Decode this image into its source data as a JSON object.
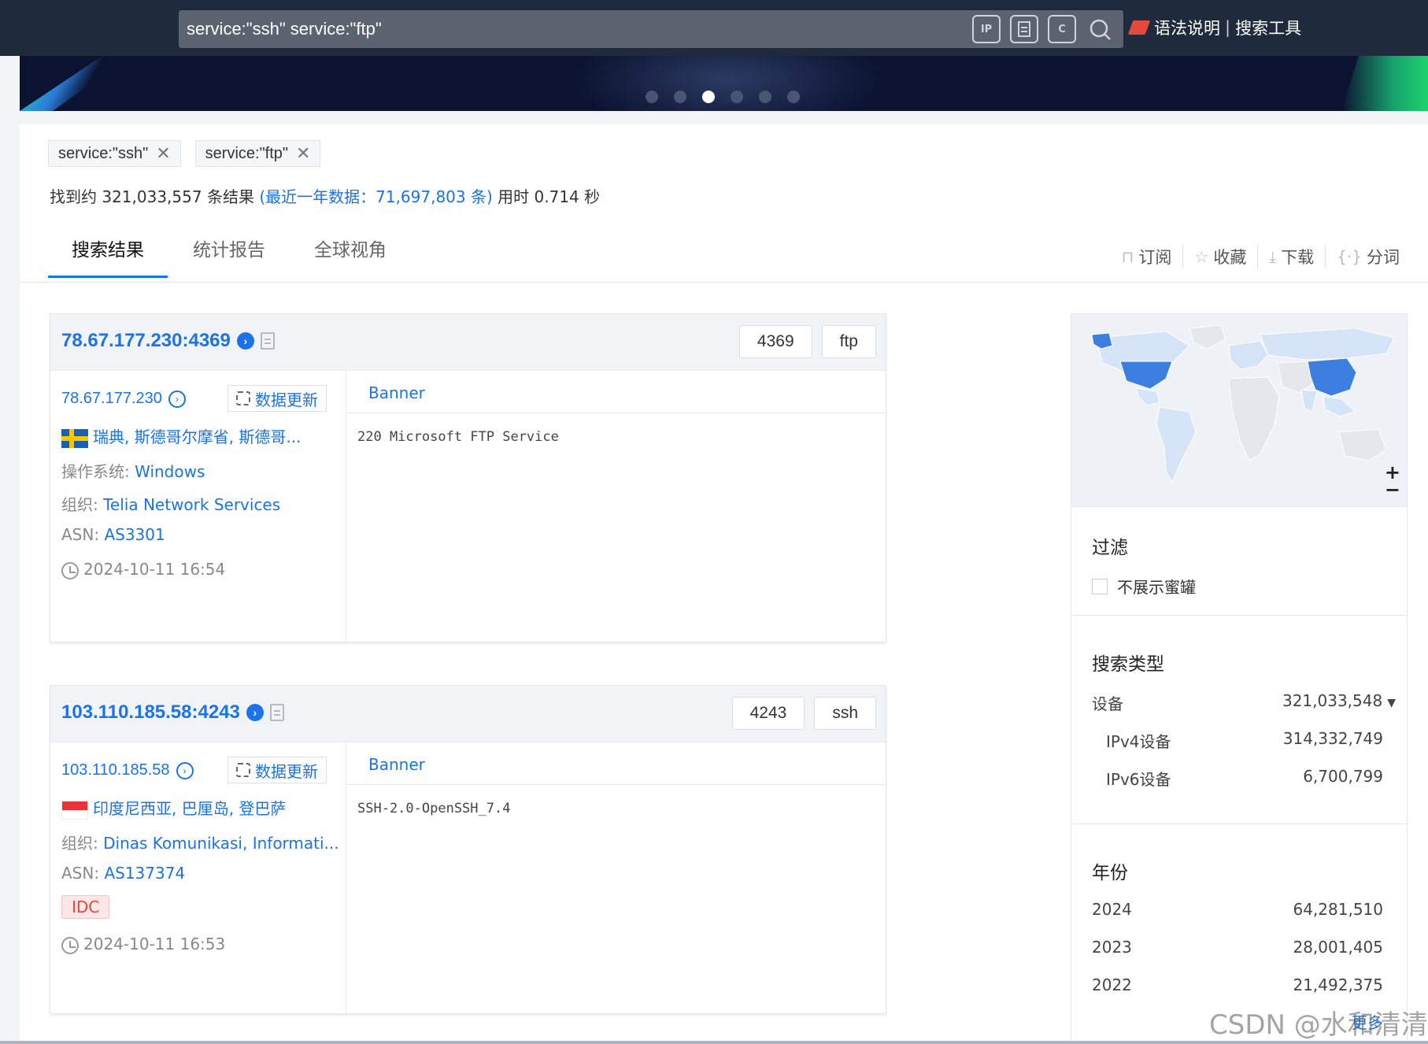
{
  "search": {
    "query": "service:\"ssh\" service:\"ftp\"",
    "tools": [
      "IP",
      "File",
      "C"
    ],
    "links": {
      "syntax": "语法说明",
      "separator": "|",
      "tools": "搜索工具"
    }
  },
  "carousel": {
    "count": 6,
    "active_index": 2
  },
  "filters": {
    "chips": [
      {
        "label": "service:\"ssh\""
      },
      {
        "label": "service:\"ftp\""
      }
    ],
    "close_glyph": "✕"
  },
  "summary": {
    "prefix": "找到约 321,033,557 条结果",
    "recent": "(最近一年数据：71,697,803 条)",
    "time": "用时 0.714 秒"
  },
  "tabs": [
    {
      "label": "搜索结果",
      "active": true
    },
    {
      "label": "统计报告",
      "active": false
    },
    {
      "label": "全球视角",
      "active": false
    }
  ],
  "actions": [
    {
      "icon": "bookmark-icon",
      "glyph": "⊓",
      "label": "订阅"
    },
    {
      "icon": "star-icon",
      "glyph": "☆",
      "label": "收藏"
    },
    {
      "icon": "download-icon",
      "glyph": "⤓",
      "label": "下载"
    },
    {
      "icon": "braces-icon",
      "glyph": "{·}",
      "label": "分词"
    }
  ],
  "results": [
    {
      "title": "78.67.177.230:4369",
      "tags": [
        "4369",
        "ftp"
      ],
      "ip": "78.67.177.230",
      "update_label": "数据更新",
      "location": "瑞典, 斯德哥尔摩省, 斯德哥...",
      "os_label": "操作系统: ",
      "os": "Windows",
      "org_label": "组织: ",
      "org": "Telia Network Services",
      "asn_label": "ASN: ",
      "asn": "AS3301",
      "time": "2024-10-11 16:54",
      "banner_tab": "Banner",
      "banner": "220 Microsoft FTP Service"
    },
    {
      "title": "103.110.185.58:4243",
      "tags": [
        "4243",
        "ssh"
      ],
      "ip": "103.110.185.58",
      "update_label": "数据更新",
      "location": "印度尼西亚, 巴厘岛, 登巴萨",
      "org_label": "组织: ",
      "org": "Dinas Komunikasi, Informati...",
      "asn_label": "ASN: ",
      "asn": "AS137374",
      "badge": "IDC",
      "time": "2024-10-11 16:53",
      "banner_tab": "Banner",
      "banner": "SSH-2.0-OpenSSH_7.4"
    }
  ],
  "sidebar": {
    "zoom_in": "+",
    "zoom_out": "−",
    "filter_title": "过滤",
    "honeypot_label": "不展示蜜罐",
    "type_title": "搜索类型",
    "types": [
      {
        "label": "设备",
        "value": "321,033,548"
      },
      {
        "label": "IPv4设备",
        "value": "314,332,749"
      },
      {
        "label": "IPv6设备",
        "value": "6,700,799"
      }
    ],
    "year_title": "年份",
    "years": [
      {
        "label": "2024",
        "value": "64,281,510"
      },
      {
        "label": "2023",
        "value": "28,001,405"
      },
      {
        "label": "2022",
        "value": "21,492,375"
      }
    ],
    "more": "更多"
  },
  "watermark": "CSDN @水和清清",
  "colors": {
    "accent": "#1a73e8",
    "header": "#1f2a3c",
    "badge_red": "#e24a3b"
  }
}
